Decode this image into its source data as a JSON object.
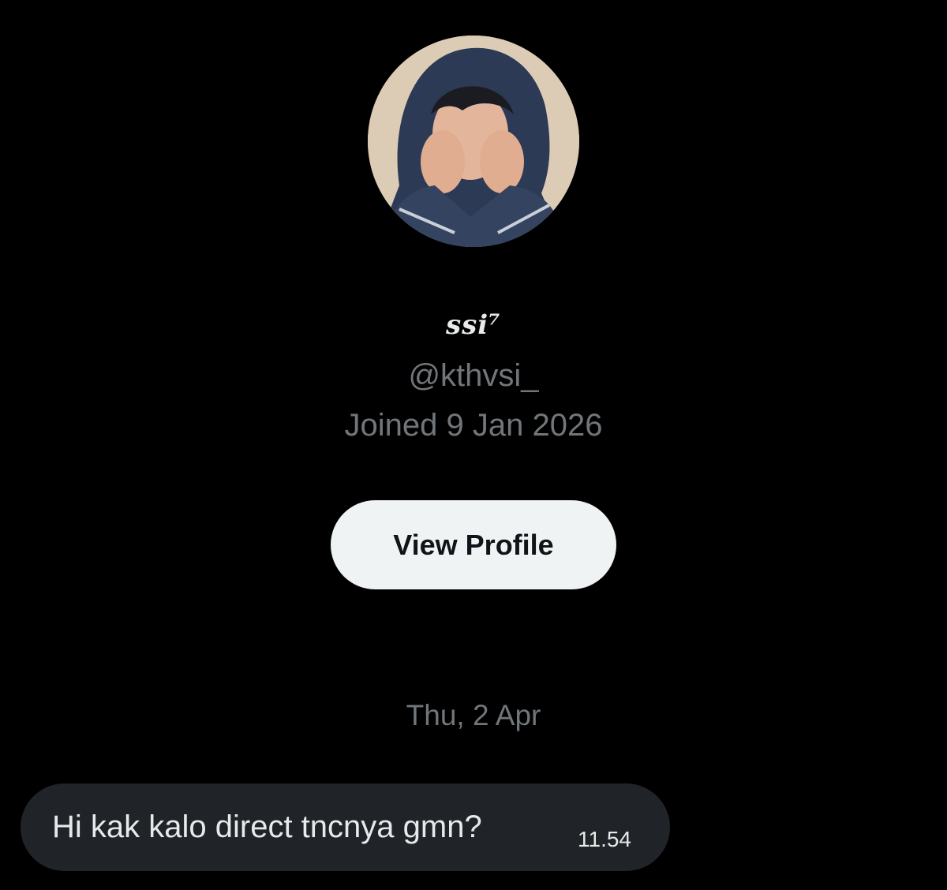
{
  "profile": {
    "avatar_icon": "profile-photo",
    "display_name": "ssi⁷",
    "handle": "@kthvsi_",
    "joined": "Joined 9 Jan 2026",
    "view_profile_label": "View Profile"
  },
  "conversation": {
    "date_separator": "Thu, 2 Apr",
    "messages": [
      {
        "text": "Hi kak kalo direct tncnya gmn?",
        "time": "11.54"
      }
    ]
  },
  "colors": {
    "background": "#000000",
    "primary_text": "#e7e9ea",
    "secondary_text": "#71767b",
    "button_bg": "#eff3f4",
    "bubble_bg": "#202327"
  }
}
